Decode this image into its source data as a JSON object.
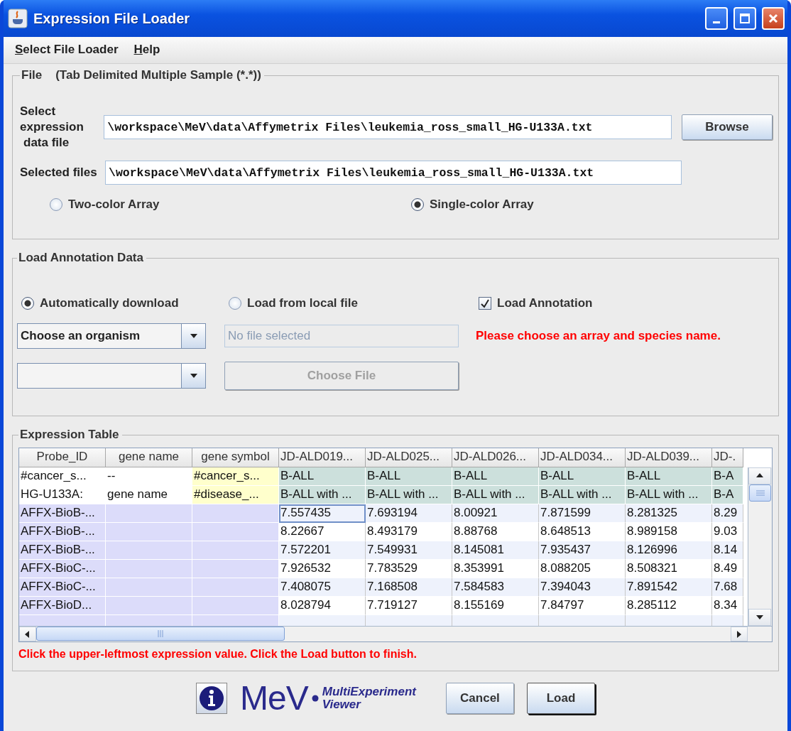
{
  "window": {
    "title": "Expression File Loader"
  },
  "menu": [
    {
      "label": "Select File Loader"
    },
    {
      "label": "Help"
    }
  ],
  "file_section": {
    "title": "File",
    "subtitle": "(Tab Delimited Multiple Sample (*.*))",
    "select_label_lines": [
      "Select",
      "expression",
      "data file"
    ],
    "select_value": "\\workspace\\MeV\\data\\Affymetrix Files\\leukemia_ross_small_HG-U133A.txt",
    "browse_button": "Browse",
    "selected_label": "Selected files",
    "selected_value": "\\workspace\\MeV\\data\\Affymetrix Files\\leukemia_ross_small_HG-U133A.txt",
    "array_types": [
      {
        "label": "Two-color Array",
        "selected": false
      },
      {
        "label": "Single-color Array",
        "selected": true
      }
    ]
  },
  "annotation_section": {
    "title": "Load Annotation Data",
    "sources": [
      {
        "label": "Automatically download",
        "selected": true
      },
      {
        "label": "Load from local file",
        "selected": false
      }
    ],
    "load_annotation": {
      "label": "Load Annotation",
      "checked": true
    },
    "organism_combo": {
      "value": "Choose an organism"
    },
    "file_field": {
      "placeholder": "No file selected",
      "disabled": true
    },
    "choose_file_button": {
      "label": "Choose File",
      "disabled": true
    },
    "message": "Please choose an array and species name."
  },
  "table_section": {
    "title": "Expression Table",
    "table": {
      "columns": [
        {
          "label": "Probe_ID",
          "kind": "id",
          "selected": false
        },
        {
          "label": "gene name",
          "kind": "id",
          "selected": false
        },
        {
          "label": "gene symbol",
          "kind": "symbol",
          "selected": false
        },
        {
          "label": "JD-ALD019...",
          "kind": "sample",
          "selected": true
        },
        {
          "label": "JD-ALD025...",
          "kind": "sample",
          "selected": false
        },
        {
          "label": "JD-ALD026...",
          "kind": "sample",
          "selected": false
        },
        {
          "label": "JD-ALD034...",
          "kind": "sample",
          "selected": false
        },
        {
          "label": "JD-ALD039...",
          "kind": "sample",
          "selected": false
        },
        {
          "label": "JD-.",
          "kind": "sample",
          "selected": false
        }
      ],
      "rows": [
        {
          "kind": "info",
          "selected": false,
          "cells": [
            "#cancer_s...",
            "--",
            "#cancer_s...",
            "B-ALL",
            "B-ALL",
            "B-ALL",
            "B-ALL",
            "B-ALL",
            "B-A"
          ]
        },
        {
          "kind": "info",
          "selected": false,
          "cells": [
            "HG-U133A:",
            "gene name",
            "#disease_...",
            "B-ALL with ...",
            "B-ALL with ...",
            "B-ALL with ...",
            "B-ALL with ...",
            "B-ALL with ...",
            "B-A"
          ]
        },
        {
          "kind": "data",
          "selected": true,
          "cells": [
            "AFFX-BioB-...",
            "",
            "",
            "7.557435",
            "7.693194",
            "8.00921",
            "7.871599",
            "8.281325",
            "8.29"
          ]
        },
        {
          "kind": "data",
          "selected": false,
          "cells": [
            "AFFX-BioB-...",
            "",
            "",
            "8.22667",
            "8.493179",
            "8.88768",
            "8.648513",
            "8.989158",
            "9.03"
          ]
        },
        {
          "kind": "data",
          "selected": false,
          "cells": [
            "AFFX-BioB-...",
            "",
            "",
            "7.572201",
            "7.549931",
            "8.145081",
            "7.935437",
            "8.126996",
            "8.14"
          ]
        },
        {
          "kind": "data",
          "selected": false,
          "cells": [
            "AFFX-BioC-...",
            "",
            "",
            "7.926532",
            "7.783529",
            "8.353991",
            "8.088205",
            "8.508321",
            "8.49"
          ]
        },
        {
          "kind": "data",
          "selected": false,
          "cells": [
            "AFFX-BioC-...",
            "",
            "",
            "7.408075",
            "7.168508",
            "7.584583",
            "7.394043",
            "7.891542",
            "7.68"
          ]
        },
        {
          "kind": "data",
          "selected": false,
          "cells": [
            "AFFX-BioD...",
            "",
            "",
            "8.028794",
            "7.719127",
            "8.155169",
            "7.84797",
            "8.285112",
            "8.34"
          ]
        }
      ]
    },
    "instruction": "Click the upper-leftmost expression value. Click the Load button to finish."
  },
  "footer": {
    "logo_name": "MeV",
    "logo_subtitle": [
      "MultiExperiment",
      "Viewer"
    ],
    "buttons": [
      {
        "label": "Cancel",
        "default": false
      },
      {
        "label": "Load",
        "default": true
      }
    ]
  }
}
